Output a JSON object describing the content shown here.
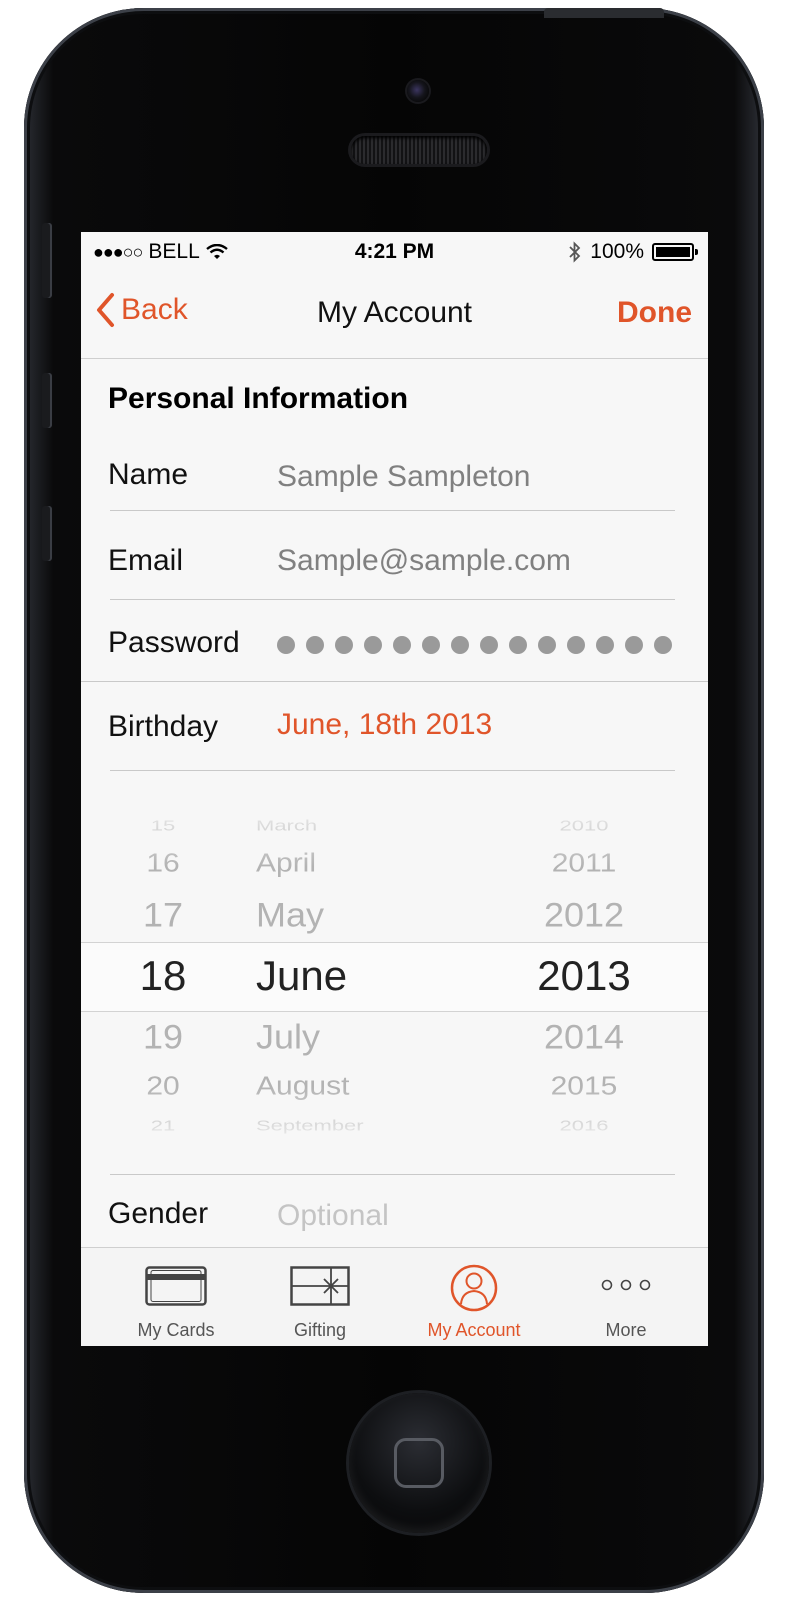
{
  "status_bar": {
    "carrier": "BELL",
    "time": "4:21 PM",
    "battery": "100%"
  },
  "nav": {
    "back_label": "Back",
    "title": "My Account",
    "done_label": "Done"
  },
  "section_title": "Personal Information",
  "form": {
    "name_label": "Name",
    "name_value": "Sample Sampleton",
    "email_label": "Email",
    "email_value": "Sample@sample.com",
    "password_label": "Password",
    "password_mask_count": 14,
    "birthday_label": "Birthday",
    "birthday_value": "June, 18th 2013",
    "gender_label": "Gender",
    "gender_placeholder": "Optional"
  },
  "date_picker": {
    "days": [
      "15",
      "16",
      "17",
      "18",
      "19",
      "20",
      "21"
    ],
    "months": [
      "March",
      "April",
      "May",
      "June",
      "July",
      "August",
      "September"
    ],
    "years": [
      "2010",
      "2011",
      "2012",
      "2013",
      "2014",
      "2015",
      "2016"
    ],
    "selected": {
      "day": "18",
      "month": "June",
      "year": "2013"
    }
  },
  "tab_bar": {
    "items": [
      {
        "label": "My Cards",
        "icon": "card-icon"
      },
      {
        "label": "Gifting",
        "icon": "gift-icon"
      },
      {
        "label": "My Account",
        "icon": "account-icon",
        "active": true
      },
      {
        "label": "More",
        "icon": "more-icon"
      }
    ]
  },
  "colors": {
    "accent": "#e0552a",
    "text": "#111111",
    "muted": "#808080",
    "placeholder": "#c4c4c4"
  }
}
